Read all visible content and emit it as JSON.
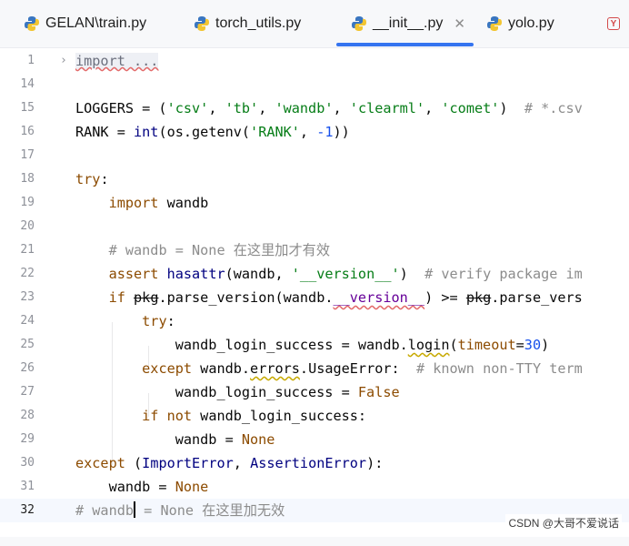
{
  "tabs": [
    {
      "label": "GELAN\\train.py"
    },
    {
      "label": "torch_utils.py"
    },
    {
      "label": "__init__.py"
    },
    {
      "label": "yolo.py"
    }
  ],
  "editor": {
    "lines": [
      {
        "num": "1",
        "folded_text": "import ..."
      },
      {
        "num": "14"
      },
      {
        "num": "15"
      },
      {
        "num": "16"
      },
      {
        "num": "17"
      },
      {
        "num": "18"
      },
      {
        "num": "19"
      },
      {
        "num": "20"
      },
      {
        "num": "21"
      },
      {
        "num": "22"
      },
      {
        "num": "23"
      },
      {
        "num": "24"
      },
      {
        "num": "25"
      },
      {
        "num": "26"
      },
      {
        "num": "27"
      },
      {
        "num": "28"
      },
      {
        "num": "29"
      },
      {
        "num": "30"
      },
      {
        "num": "31"
      },
      {
        "num": "32"
      }
    ],
    "current_line": "32"
  },
  "watermark": "CSDN @大哥不爱说话"
}
